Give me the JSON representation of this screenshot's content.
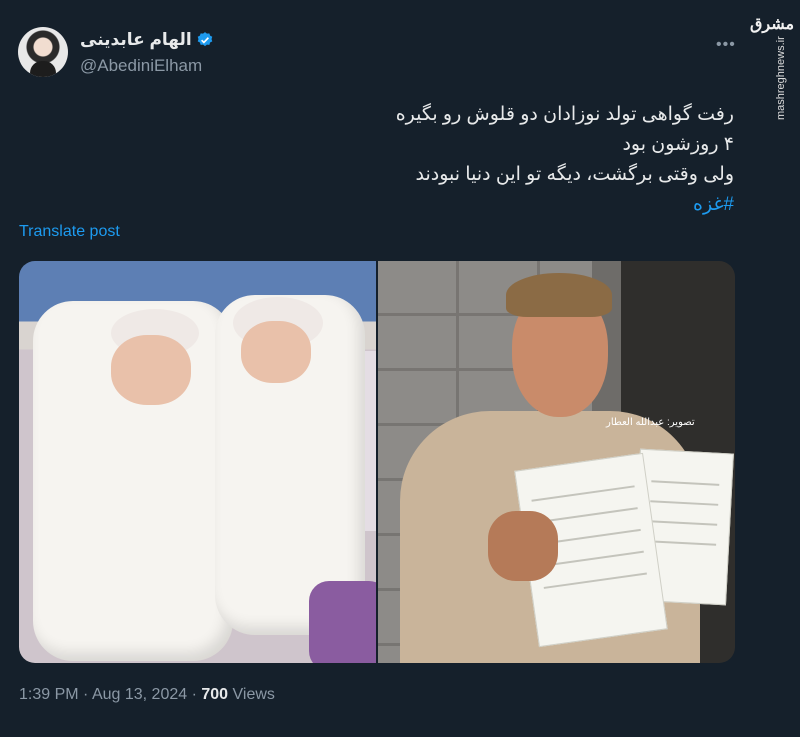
{
  "author": {
    "display_name": "الهام عابدینی",
    "handle": "@AbediniElham",
    "verified": true,
    "avatar_icon": "avatar"
  },
  "menu_icon": "more-horizontal-icon",
  "watermark": {
    "logo": "مشرق",
    "url": "mashreghnews.ir"
  },
  "tweet": {
    "lines": [
      "رفت گواهی تولد نوزادان دو قلوش رو بگیره",
      "۴ روزشون بود",
      "ولی وقتی برگشت، دیگه تو این دنیا نبودند"
    ],
    "hashtag": "#غزه"
  },
  "translate_label": "Translate post",
  "media": {
    "photo_credit": "تصوير: عبدالله العطار"
  },
  "footer": {
    "time": "1:39 PM",
    "separator": "·",
    "date": "Aug 13, 2024",
    "views_count": "700",
    "views_label": "Views"
  },
  "colors": {
    "background": "#15202b",
    "text": "#e7e9ea",
    "muted": "#8b98a5",
    "link": "#1d9bf0"
  }
}
